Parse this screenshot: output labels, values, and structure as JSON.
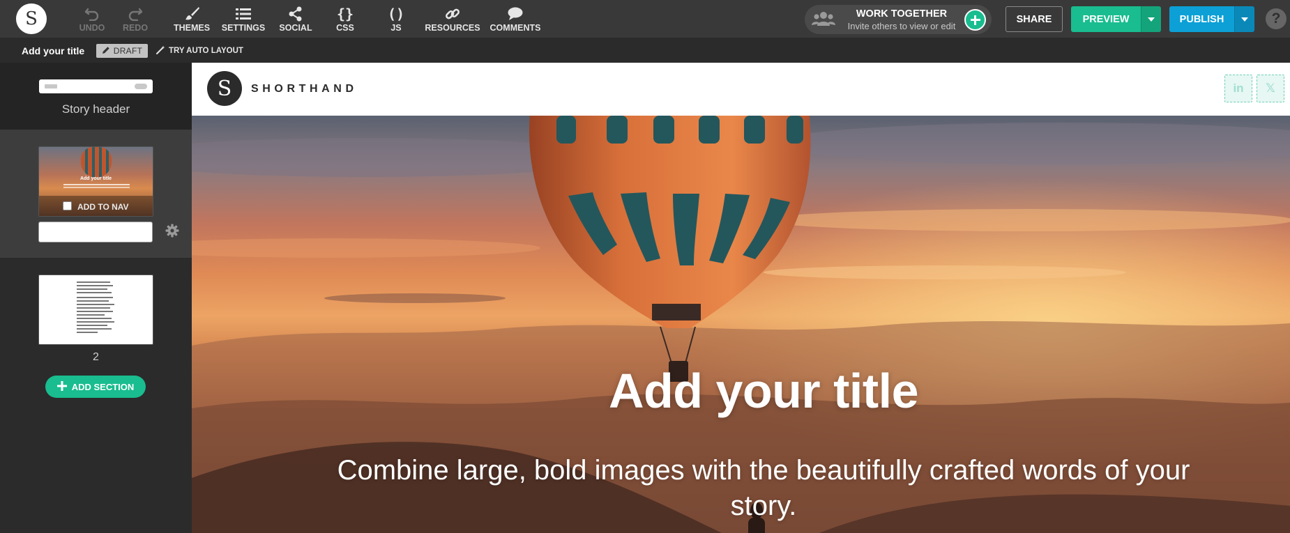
{
  "toolbar": {
    "logo_letter": "S",
    "undo": "UNDO",
    "redo": "REDO",
    "themes": "THEMES",
    "settings": "SETTINGS",
    "social": "SOCIAL",
    "css": "CSS",
    "css_glyph": "{}",
    "js": "JS",
    "js_glyph": "()",
    "resources": "RESOURCES",
    "comments": "COMMENTS",
    "work_together_title": "WORK TOGETHER",
    "work_together_sub": "Invite others to view or edit",
    "share": "SHARE",
    "preview": "PREVIEW",
    "publish": "PUBLISH",
    "help": "?"
  },
  "subbar": {
    "story_title": "Add your title",
    "draft": "DRAFT",
    "auto_layout": "TRY AUTO LAYOUT"
  },
  "sidebar": {
    "header_label": "Story header",
    "section1_mini_title": "Add your title",
    "add_to_nav": "ADD TO NAV",
    "section2_label": "2",
    "add_section": "ADD SECTION"
  },
  "canvas": {
    "logo_letter": "S",
    "brand": "SHORTHAND",
    "social_linkedin": "in",
    "social_twitter": "𝕏",
    "hero_title": "Add your title",
    "hero_subtitle": "Combine large, bold images with the beautifully crafted words of your story."
  },
  "colors": {
    "toolbar_bg": "#393939",
    "accent_green": "#19bd8f",
    "accent_blue": "#0ca0d6",
    "sidebar_bg": "#2b2b2b"
  }
}
